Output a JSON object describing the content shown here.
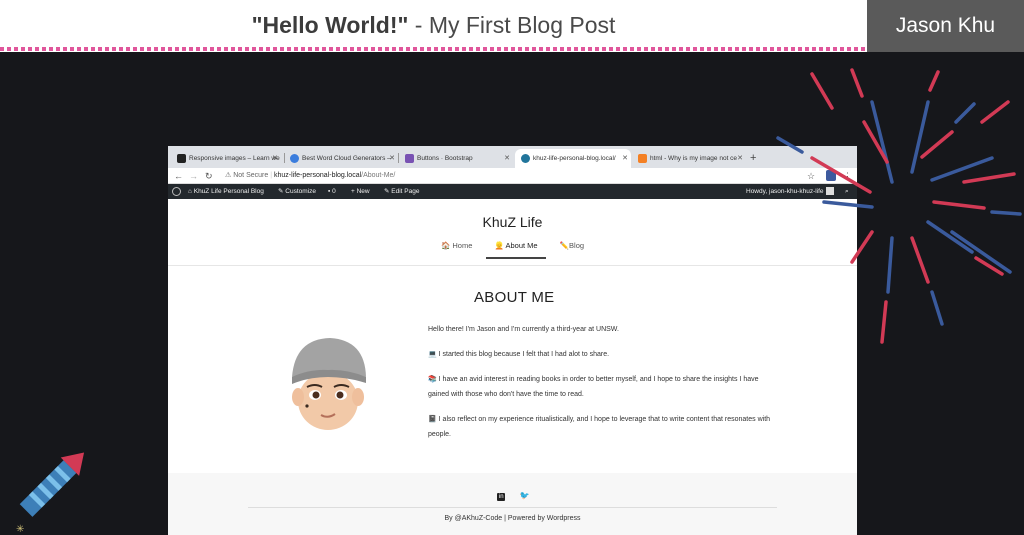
{
  "banner": {
    "title_bold": "\"Hello World!\"",
    "title_rest": " - My First Blog Post",
    "author": "Jason Khu"
  },
  "browser": {
    "tabs": [
      {
        "label": "Responsive images – Learn we",
        "favicon_color": "#222222"
      },
      {
        "label": "Best Word Cloud Generators –",
        "favicon_color": "#3b7ddd"
      },
      {
        "label": "Buttons · Bootstrap",
        "favicon_color": "#7952b3"
      },
      {
        "label": "khuz-life-personal-blog.local/",
        "favicon_color": "#21759b",
        "active": true
      },
      {
        "label": "html - Why is my image not ce",
        "favicon_color": "#f48024"
      }
    ],
    "new_tab": "+",
    "address": {
      "security": "Not Secure",
      "host": "khuz-life-personal-blog.local",
      "path": "/About-Me/"
    },
    "wp_admin_bar": {
      "site_name": "KhuZ Life Personal Blog",
      "customize": "Customize",
      "comments_count": "0",
      "new": "New",
      "edit": "Edit Page",
      "howdy": "Howdy, jason-khu-khuz-life"
    }
  },
  "site": {
    "title": "KhuZ Life",
    "menu": [
      {
        "label": "Home",
        "emoji": "🏠"
      },
      {
        "label": "About Me",
        "emoji": "👱",
        "active": true
      },
      {
        "label": "Blog",
        "emoji": "✏️"
      }
    ],
    "page_title": "ABOUT ME",
    "paragraphs": [
      "Hello there! I'm Jason and I'm currently a third-year at UNSW.",
      "💻 I started this blog because I felt that I had alot to share.",
      "📚 I have an avid interest in reading books in order to better myself, and I hope to share the insights I have gained with those who don't have the time to read.",
      "📓 I also reflect on my experience ritualistically, and I hope to leverage that to write content that resonates with people."
    ],
    "footer_credits": "By @AKhuZ-Code | Powered by Wordpress"
  },
  "colors": {
    "background": "#16171b",
    "banner_dash": "#e0569b",
    "author_box": "#5a5a5a",
    "firework_red": "#d23a55",
    "firework_blue": "#3a5a9c"
  }
}
